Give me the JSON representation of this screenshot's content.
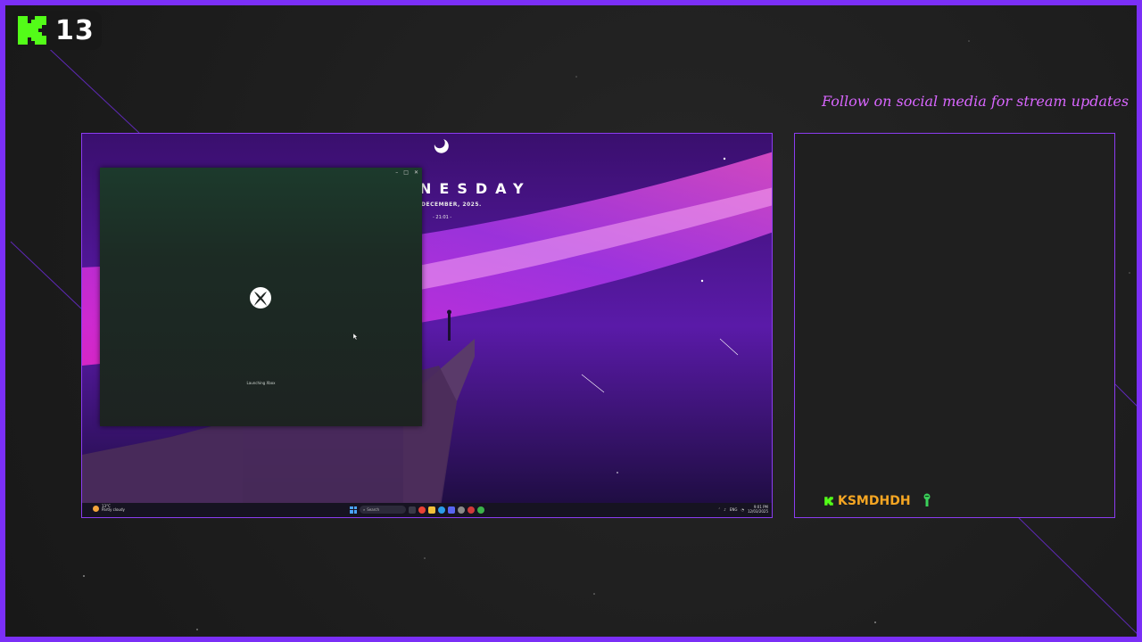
{
  "overlay": {
    "viewer_count": "13",
    "platform_icon": "kick-logo-icon",
    "social_text": "Follow on social media for stream updates",
    "colors": {
      "frame": "#7b2ff7",
      "kick_green": "#53fc18",
      "social_text": "#d966ff",
      "username": "#f5a623"
    }
  },
  "screen": {
    "desktop_day": "NESDAY",
    "desktop_date": "DECEMBER, 2025.",
    "desktop_time": "- 21:01 -",
    "xbox_window": {
      "controls": [
        "–",
        "□",
        "✕"
      ],
      "logo": "xbox-logo-icon",
      "status_text": "Launching Xbox"
    },
    "taskbar": {
      "weather_temp": "13°C",
      "weather_desc": "Partly cloudy",
      "search_placeholder": "Search",
      "tray_lang": "ENG",
      "clock_time": "9:01 PM",
      "clock_date": "12/03/2025"
    }
  },
  "chat": {
    "messages": [
      {
        "platform_icon": "kick-logo-icon",
        "username": "KSMDHDH",
        "emote": "green-alien-emote-icon"
      }
    ]
  }
}
